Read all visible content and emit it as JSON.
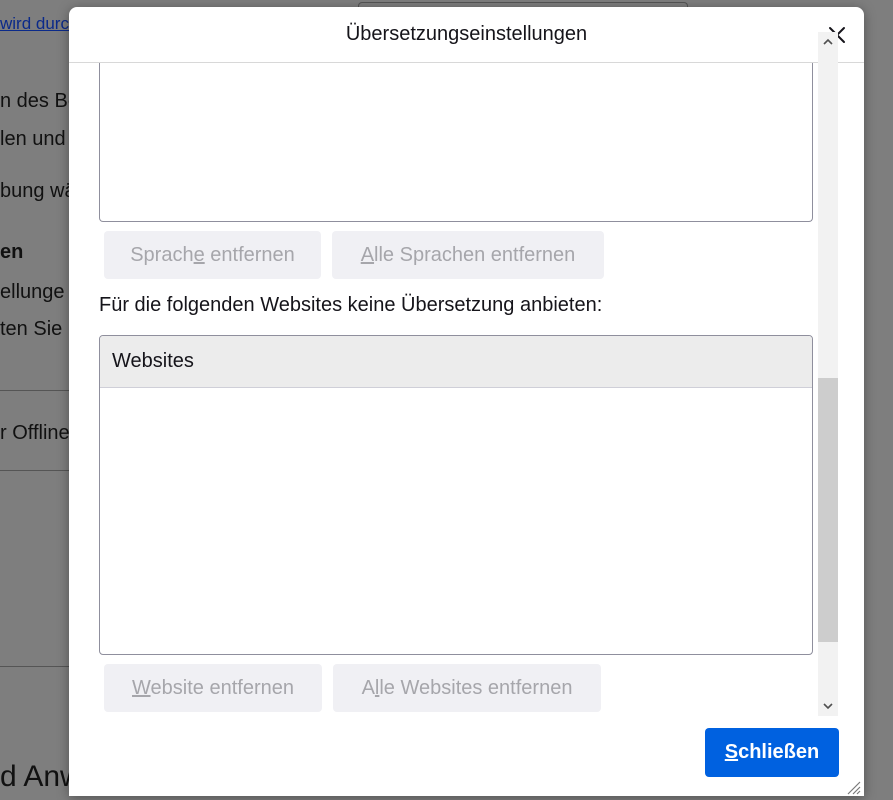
{
  "background_page": {
    "link_fragment": "wird durc",
    "line1": "n des Be",
    "line2": "len und",
    "line3": "bung wä",
    "heading_fragment": "en",
    "line4": "ellunge",
    "line5": "ten Sie",
    "line6": "r Offline",
    "line7": "d Anw"
  },
  "dialog": {
    "title": "Übersetzungseinstellungen",
    "close_icon": "close-icon",
    "languages": {
      "remove_button": {
        "pre": "Sprach",
        "accel": "e",
        "post": " entfernen"
      },
      "remove_all_button": {
        "pre": "",
        "accel": "A",
        "post": "lle Sprachen entfernen"
      }
    },
    "websites": {
      "section_label": "Für die folgenden Websites keine Übersetzung anbieten:",
      "column_header": "Websites",
      "rows": [],
      "remove_button": {
        "pre": "",
        "accel": "W",
        "post": "ebsite entfernen"
      },
      "remove_all_button": {
        "pre": "A",
        "accel": "l",
        "post": "le Websites entfernen"
      }
    },
    "footer": {
      "close_button": {
        "pre": "",
        "accel": "S",
        "post": "chließen"
      }
    }
  },
  "colors": {
    "accent": "#0061e0",
    "disabled_text": "#a6a6ab",
    "button_bg": "#f0f0f4"
  }
}
